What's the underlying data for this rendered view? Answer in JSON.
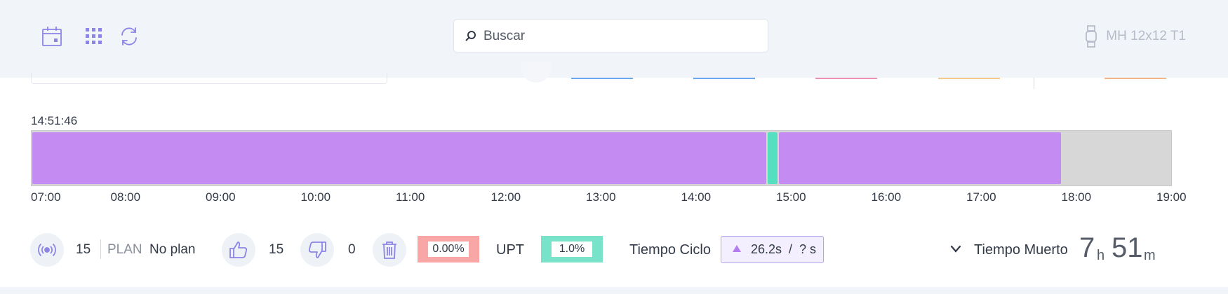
{
  "header": {
    "search_placeholder": "Buscar",
    "machine_label": "MH 12x12 T1"
  },
  "timeline": {
    "start_time": "14:51:46",
    "ticks": [
      "07:00",
      "08:00",
      "09:00",
      "10:00",
      "11:00",
      "12:00",
      "13:00",
      "14:00",
      "15:00",
      "16:00",
      "17:00",
      "18:00",
      "19:00"
    ],
    "segments": [
      {
        "start": "07:00",
        "end": "14:44",
        "color": "#c48bf2"
      },
      {
        "start": "14:44",
        "end": "14:51",
        "color": "#55dfc0"
      },
      {
        "start": "14:51",
        "end": "17:50",
        "color": "#c48bf2"
      }
    ],
    "empty_color": "#d7d7d7"
  },
  "stats": {
    "signal_count": "15",
    "plan_label": "PLAN",
    "plan_value": "No plan",
    "good_count": "15",
    "bad_count": "0",
    "scrap_pct": "0.00%",
    "upt_label": "UPT",
    "upt_pct": "1.0%",
    "ciclo_label": "Tiempo Ciclo",
    "ciclo_value": "26.2s  /  ? s",
    "muerto_label": "Tiempo Muerto",
    "muerto_hours": "7",
    "hours_unit": "h",
    "muerto_minutes": "51",
    "minutes_unit": "m"
  },
  "colors": {
    "accent": "#8c85e6",
    "scrap_bg": "#f9a6a6",
    "upt_bg": "#78e3c8",
    "run": "#c48bf2",
    "stop": "#55dfc0"
  },
  "icons": [
    "calendar-icon",
    "grid-icon",
    "refresh-icon",
    "search-icon",
    "watch-icon",
    "signal-icon",
    "thumbs-up-icon",
    "thumbs-down-icon",
    "trash-icon",
    "triangle-up-icon",
    "chevron-down-icon"
  ]
}
